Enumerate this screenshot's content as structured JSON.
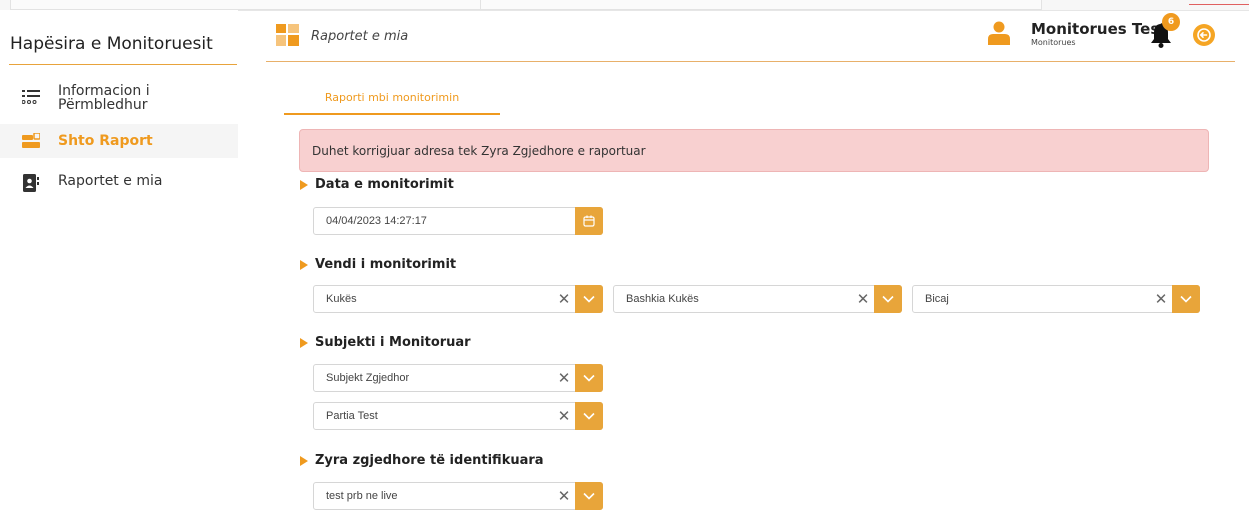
{
  "sidebar": {
    "title": "Hapësira e Monitoruesit",
    "items": [
      {
        "label_line1": "Informacion i",
        "label_line2": "Përmbledhur",
        "icon": "list-icon"
      },
      {
        "label": "Shto Raport",
        "icon": "add-report-icon",
        "active": true
      },
      {
        "label": "Raportet e mia",
        "icon": "contacts-book-icon"
      }
    ]
  },
  "header": {
    "title": "Raportet e mia",
    "user_name": "Monitorues Test",
    "user_role": "Monitorues",
    "notification_count": "6"
  },
  "tabs": {
    "active": "Raporti mbi monitorimin"
  },
  "alert": {
    "message": "Duhet korrigjuar adresa tek Zyra Zgjedhore e raportuar"
  },
  "sections": {
    "date": {
      "title": "Data e monitorimit",
      "value": "04/04/2023 14:27:17"
    },
    "location": {
      "title": "Vendi i monitorimit",
      "region": "Kukës",
      "municipality": "Bashkia Kukës",
      "unit": "Bicaj"
    },
    "subject": {
      "title": "Subjekti i Monitoruar",
      "type": "Subjekt Zgjedhor",
      "party": "Partia Test"
    },
    "offices": {
      "title": "Zyra zgjedhore të identifikuara",
      "value": "test prb ne live"
    }
  },
  "colors": {
    "accent": "#ef9a1f",
    "alert_bg": "#f8d0d0"
  }
}
